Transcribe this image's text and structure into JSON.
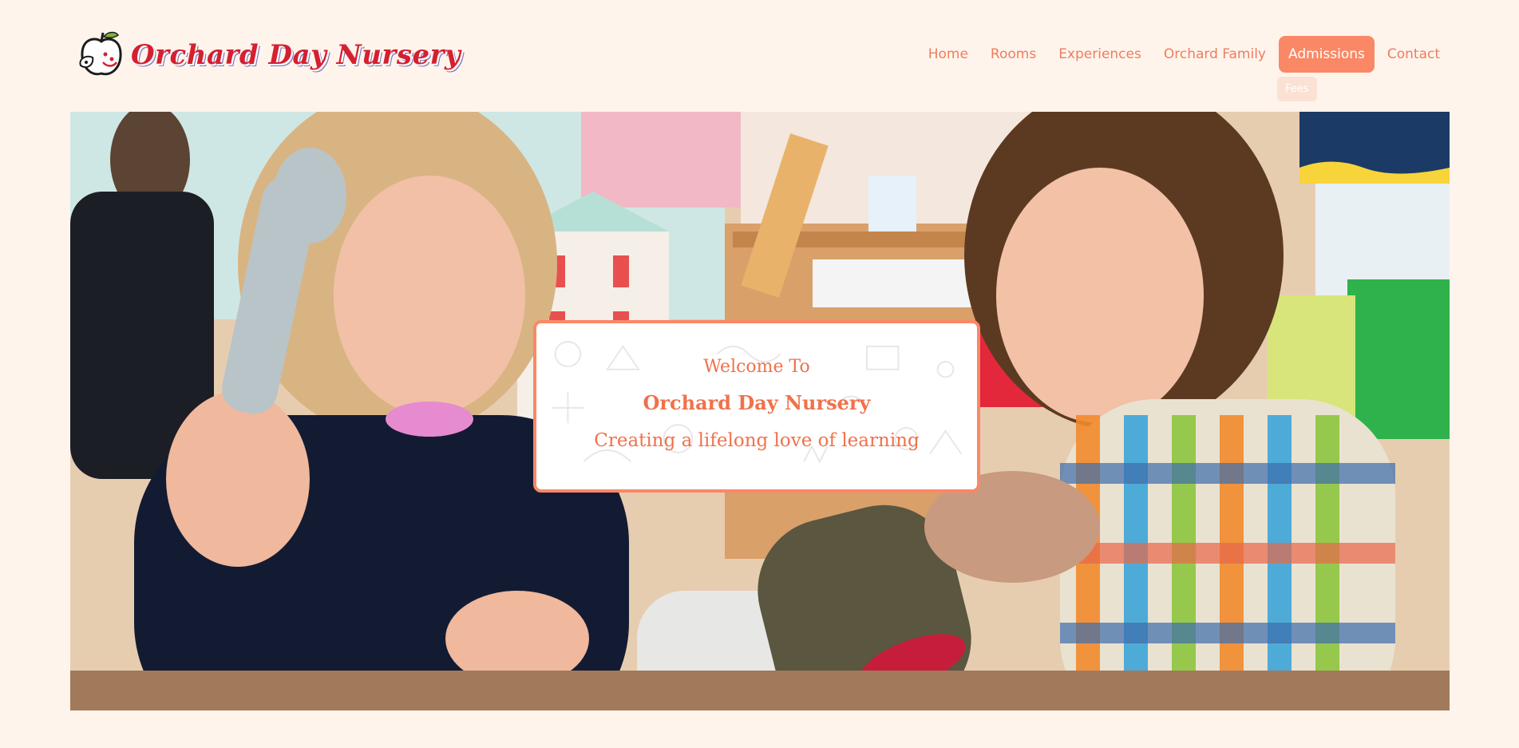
{
  "brand": {
    "name": "Orchard Day Nursery",
    "logo_icon": "apple-logo-icon",
    "colors": {
      "brand_red": "#d42030",
      "accent": "#fa8866",
      "page_bg": "#fff4ec"
    }
  },
  "nav": {
    "items": [
      {
        "label": "Home"
      },
      {
        "label": "Rooms"
      },
      {
        "label": "Experiences"
      },
      {
        "label": "Orchard Family"
      },
      {
        "label": "Admissions",
        "active": true
      },
      {
        "label": "Contact"
      }
    ],
    "submenu": {
      "parent": "Admissions",
      "items": [
        {
          "label": "Fees"
        }
      ]
    }
  },
  "hero": {
    "image_icon": "hero-photo",
    "welcome": {
      "line1": "Welcome To",
      "line2": "Orchard Day Nursery",
      "line3": "Creating a lifelong love of learning"
    }
  }
}
